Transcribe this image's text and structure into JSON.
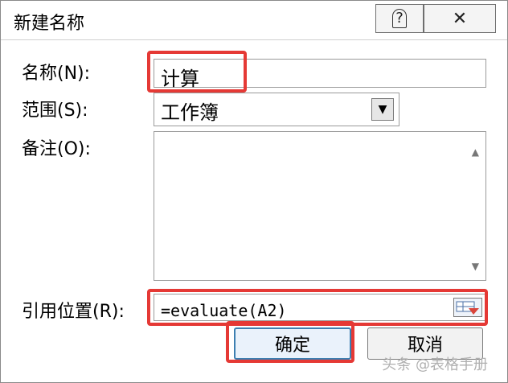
{
  "window": {
    "title": "新建名称",
    "help_label": "?",
    "close_label": "✕"
  },
  "form": {
    "name_label": "名称(N):",
    "name_value": "计算",
    "scope_label": "范围(S):",
    "scope_value": "工作簿",
    "comment_label": "备注(O):",
    "comment_value": "",
    "refers_label": "引用位置(R):",
    "refers_value": "=evaluate(A2)"
  },
  "buttons": {
    "ok": "确定",
    "cancel": "取消"
  },
  "watermark": "头条 @表格手册",
  "colors": {
    "highlight": "#e53935",
    "primary_border": "#3c7fb1"
  }
}
